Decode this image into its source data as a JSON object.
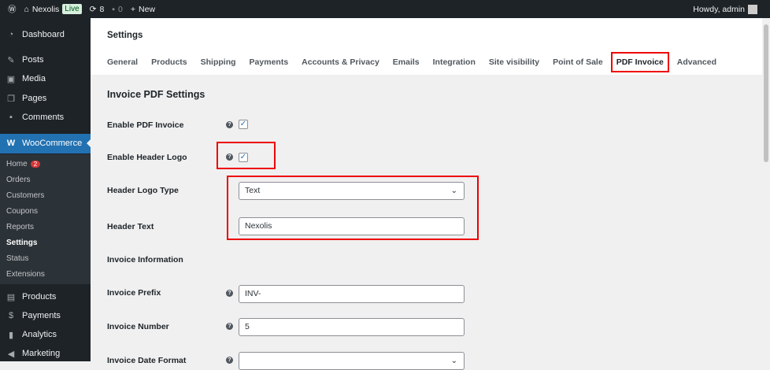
{
  "adminbar": {
    "site": "Nexolis",
    "live": "Live",
    "updates": "8",
    "comments": "0",
    "new": "New",
    "howdy": "Howdy, admin"
  },
  "sidebar": {
    "items": [
      "Dashboard",
      "Posts",
      "Media",
      "Pages",
      "Comments",
      "WooCommerce",
      "Products",
      "Payments",
      "Analytics",
      "Marketing"
    ],
    "sub": [
      "Home",
      "Orders",
      "Customers",
      "Coupons",
      "Reports",
      "Settings",
      "Status",
      "Extensions"
    ],
    "home_badge": "2"
  },
  "header": {
    "title": "Settings",
    "tabs": [
      "General",
      "Products",
      "Shipping",
      "Payments",
      "Accounts & Privacy",
      "Emails",
      "Integration",
      "Site visibility",
      "Point of Sale",
      "PDF Invoice",
      "Advanced"
    ]
  },
  "main": {
    "heading": "Invoice PDF Settings",
    "enable_pdf": "Enable PDF Invoice",
    "enable_logo": "Enable Header Logo",
    "logo_type": "Header Logo Type",
    "logo_type_value": "Text",
    "header_text": "Header Text",
    "header_text_value": "Nexolis",
    "info": "Invoice Information",
    "prefix": "Invoice Prefix",
    "prefix_value": "INV-",
    "number": "Invoice Number",
    "number_value": "5",
    "date_format": "Invoice Date Format"
  }
}
